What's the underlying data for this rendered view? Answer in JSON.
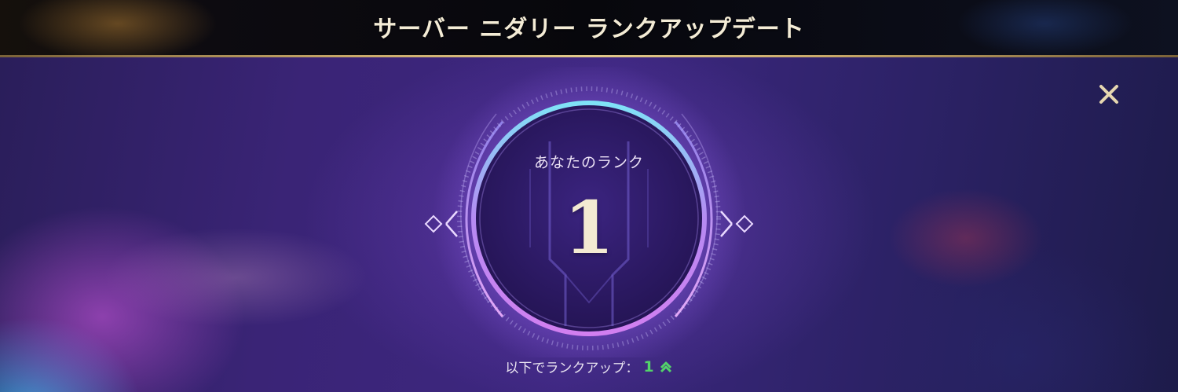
{
  "header": {
    "title": "サーバー ニダリー ランクアップデート"
  },
  "rank": {
    "label": "あなたのランク",
    "value": "1"
  },
  "rankup": {
    "label": "以下でランクアップ：",
    "value": "1",
    "icon": "double-chevron-up-icon"
  },
  "close": {
    "icon": "close-icon"
  },
  "colors": {
    "title_text": "#f4ecd6",
    "header_border": "#c9a96a",
    "rankup_value": "#53d36a",
    "close_icon": "#e6d7b0",
    "ring_cyan": "#6fd6f0",
    "ring_purple": "#c07cf0"
  }
}
